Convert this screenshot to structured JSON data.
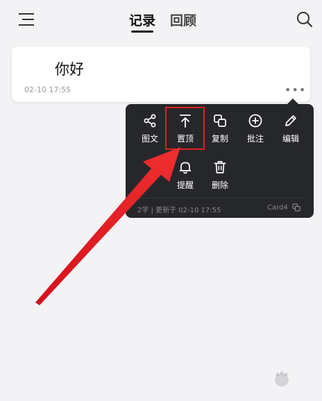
{
  "header": {
    "tabs": [
      {
        "label": "记录",
        "active": true
      },
      {
        "label": "回顾",
        "active": false
      }
    ]
  },
  "note": {
    "text": "你好",
    "time": "02-10 17:55",
    "more": "•••"
  },
  "popup": {
    "items": [
      {
        "label": "图文",
        "icon": "share-icon"
      },
      {
        "label": "置顶",
        "icon": "pin-top-icon"
      },
      {
        "label": "复制",
        "icon": "copy-icon"
      },
      {
        "label": "批注",
        "icon": "add-circle-icon"
      },
      {
        "label": "编辑",
        "icon": "pencil-icon"
      },
      {
        "label": "提醒",
        "icon": "bell-icon"
      },
      {
        "label": "删除",
        "icon": "trash-icon"
      }
    ],
    "footer_left": "2字 | 更新于 02-10 17:55",
    "footer_right": "Card4"
  },
  "colors": {
    "popup_bg": "#26272b",
    "highlight": "#e02020",
    "page_bg": "#f3f3f5"
  }
}
